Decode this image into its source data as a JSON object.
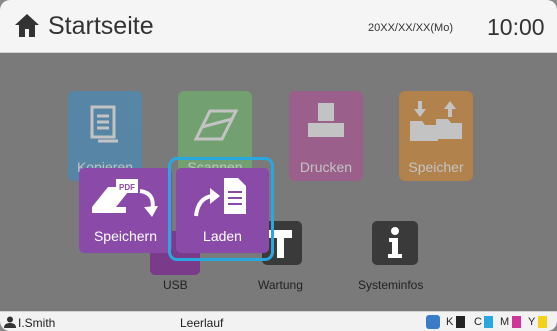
{
  "header": {
    "title": "Startseite",
    "date": "20XX/XX/XX(Mo)",
    "time": "10:00"
  },
  "tiles": {
    "kopieren": "Kopieren",
    "scannen": "Scannen",
    "drucken": "Drucken",
    "speicher": "Speicher"
  },
  "popup": {
    "speichern": "Speichern",
    "laden": "Laden"
  },
  "bottom_apps": {
    "usb": "USB",
    "wartung": "Wartung",
    "systeminfos": "Systeminfos"
  },
  "status": {
    "user": "I.Smith",
    "state": "Leerlauf",
    "inks": [
      "K",
      "C",
      "M",
      "Y"
    ]
  },
  "colors": {
    "accent": "#29a8e0",
    "popup": "#8a4aa8",
    "kopieren": "#3a8fcb",
    "scannen": "#6dc06a",
    "drucken": "#b54a98",
    "speicher": "#e08a28"
  }
}
